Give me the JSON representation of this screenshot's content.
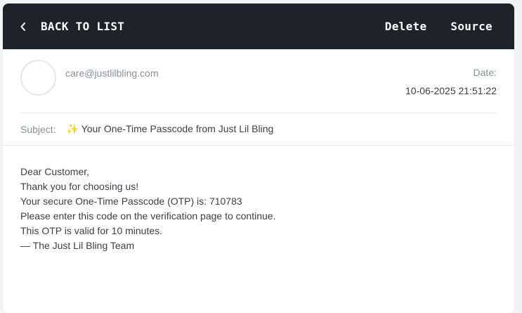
{
  "toolbar": {
    "back_label": "BACK TO LIST",
    "delete_label": "Delete",
    "source_label": "Source"
  },
  "email": {
    "from": "care@justlilbling.com",
    "date_label": "Date:",
    "date_value": "10-06-2025 21:51:22",
    "subject_label": "Subject:",
    "subject": "✨ Your One-Time Passcode from Just Lil Bling",
    "body_lines": [
      "Dear Customer,",
      "Thank you for choosing us!",
      "Your secure One-Time Passcode (OTP) is: 710783",
      "Please enter this code on the verification page to continue.",
      "This OTP is valid for 10 minutes.",
      "— The Just Lil Bling Team"
    ]
  },
  "colors": {
    "header_bg": "#1f2229",
    "header_text": "#ffffff",
    "muted_text": "#8b8f97",
    "body_text": "#3d4048"
  },
  "icons": {
    "back": "chevron-left-icon",
    "avatar": "avatar-circle"
  }
}
